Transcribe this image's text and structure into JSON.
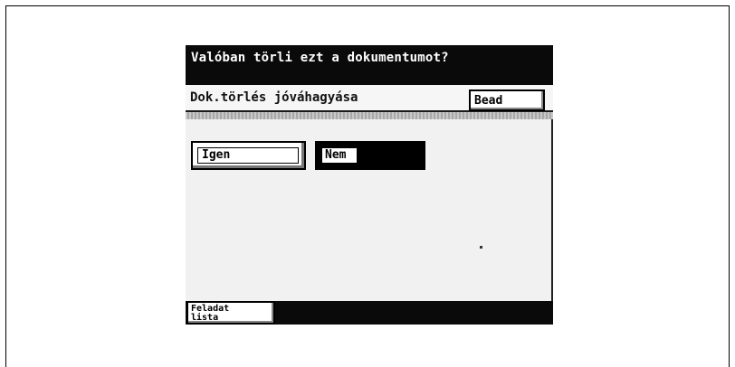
{
  "prompt": "Valóban törli ezt a dokumentumot?",
  "title": "Dok.törlés jóváhagyása",
  "buttons": {
    "enter": "Bead",
    "yes": "Igen",
    "no": "Nem"
  },
  "footer": {
    "job_list_line1": "Feladat",
    "job_list_line2": "lista"
  }
}
